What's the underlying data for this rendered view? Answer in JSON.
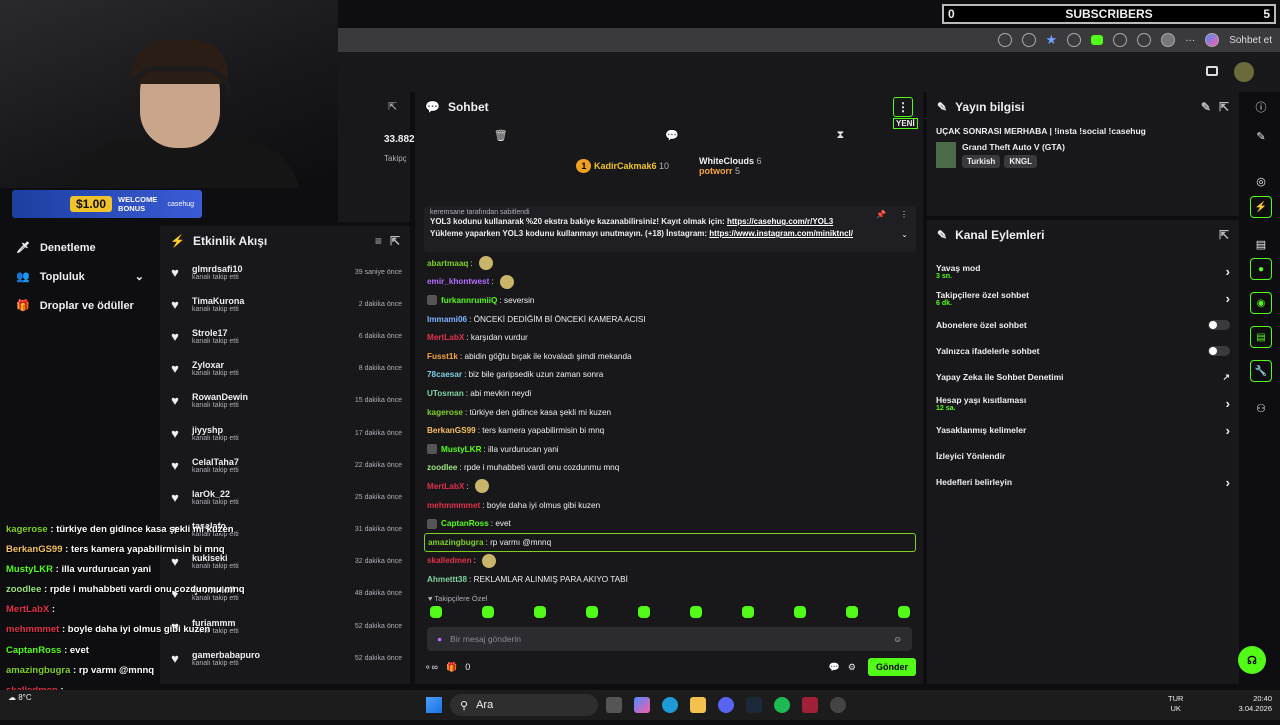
{
  "overlay_bar": {
    "left_count": "0",
    "label": "SUBSCRIBERS",
    "right_count": "5"
  },
  "browser": {
    "copilot_label": "Sohbet et"
  },
  "bonus": {
    "amount": "$1.00",
    "label": "WELCOME BONUS",
    "brand": "casehug"
  },
  "left_nav": [
    {
      "label": "Denetleme",
      "icon": "sword-icon"
    },
    {
      "label": "Topluluk",
      "icon": "community-icon"
    },
    {
      "label": "Droplar ve ödüller",
      "icon": "gift-icon"
    }
  ],
  "stats": {
    "viewers": "33.882",
    "followers_label": "Takipç"
  },
  "feed": {
    "title": "Etkinlik Akışı",
    "items": [
      {
        "name": "glmrdsafi10",
        "sub": "kanalı takip etti",
        "time": "39 saniye önce"
      },
      {
        "name": "TimaKurona",
        "sub": "kanalı takip etti",
        "time": "2 dakika önce"
      },
      {
        "name": "Strole17",
        "sub": "kanalı takip etti",
        "time": "6 dakika önce"
      },
      {
        "name": "Zyloxar",
        "sub": "kanalı takip etti",
        "time": "8 dakika önce"
      },
      {
        "name": "RowanDewin",
        "sub": "kanalı takip etti",
        "time": "15 dakika önce"
      },
      {
        "name": "jiyyshp",
        "sub": "kanalı takip etti",
        "time": "17 dakika önce"
      },
      {
        "name": "CelalTaha7",
        "sub": "kanalı takip etti",
        "time": "22 dakika önce"
      },
      {
        "name": "larOk_22",
        "sub": "kanalı takip etti",
        "time": "25 dakika önce"
      },
      {
        "name": "tasalafo",
        "sub": "kanalı takip etti",
        "time": "31 dakika önce"
      },
      {
        "name": "kukiseki",
        "sub": "kanalı takip etti",
        "time": "32 dakika önce"
      },
      {
        "name": "tjevoudoll",
        "sub": "kanalı takip etti",
        "time": "48 dakika önce"
      },
      {
        "name": "furiammm",
        "sub": "kanalı takip etti",
        "time": "52 dakika önce"
      },
      {
        "name": "gamerbabapuro",
        "sub": "kanalı takip etti",
        "time": "52 dakika önce"
      }
    ]
  },
  "chat": {
    "title": "Sohbet",
    "new_badge": "YENİ",
    "leaders": [
      {
        "name": "KadirCakmak6",
        "count": "10",
        "rank": "1"
      },
      {
        "name": "WhiteClouds",
        "count": "6"
      },
      {
        "name": "potworr",
        "count": "5"
      }
    ],
    "pinned": {
      "by": "keremsane tarafından sabitlendi",
      "line1": "YOL3 kodunu kullanarak %20 ekstra bakiye kazanabilirsiniz! Kayıt olmak için: ",
      "link1": "https://casehug.com/r/YOL3",
      "line2": "Yükleme yaparken YOL3 kodunu kullanmayı unutmayın. (+18) İnstagram: ",
      "link2": "https://www.instagram.com/miniktncl/"
    },
    "messages": [
      {
        "user": "abartmaaq",
        "text": "",
        "color": "#7fd120",
        "emote": true
      },
      {
        "user": "emir_khontwest",
        "text": "",
        "color": "#b36bff",
        "emote": true
      },
      {
        "user": "furkannrumiiQ",
        "text": "seversin",
        "color": "#53fc18",
        "badge": true
      },
      {
        "user": "Immami06",
        "text": "ÖNCEKİ DEDİĞİM Bİ ÖNCEKİ KAMERA ACISI",
        "color": "#7fb2ff"
      },
      {
        "user": "MertLabX",
        "text": "karşıdan vurdur",
        "color": "#e0304a"
      },
      {
        "user": "Fusst1k",
        "text": "abidin göğtu bıçak ile kovaladı şimdi mekanda",
        "color": "#f4a340"
      },
      {
        "user": "78caesar",
        "text": "biz bile garipsedik uzun zaman sonra",
        "color": "#7ad0e0"
      },
      {
        "user": "UTosman",
        "text": "abi mevkin neydi",
        "color": "#7fd1a0"
      },
      {
        "user": "kagerose",
        "text": "türkiye den gidince kasa şekli mi kuzen",
        "color": "#7fd120"
      },
      {
        "user": "BerkanGS99",
        "text": "ters kamera yapabilirmisin bi mnq",
        "color": "#f4c060"
      },
      {
        "user": "MustyLKR",
        "text": "illa vurdurucan yani",
        "color": "#53fc18",
        "badge": true
      },
      {
        "user": "zoodlee",
        "text": "rpde i muhabbeti vardi onu cozdunmu mnq",
        "color": "#9ee57a"
      },
      {
        "user": "MertLabX",
        "text": "",
        "color": "#e0304a",
        "emote": true
      },
      {
        "user": "mehmmmmet",
        "text": "boyle daha iyi olmus gibi kuzen",
        "color": "#e0304a"
      },
      {
        "user": "CaptanRoss",
        "text": "evet",
        "color": "#53fc18",
        "badge": true
      },
      {
        "user": "amazingbugra",
        "text": "rp varmı @mnnq",
        "color": "#7fd120",
        "highlight": true
      },
      {
        "user": "skalledmen",
        "text": "",
        "color": "#e0304a",
        "emote": true
      },
      {
        "user": "Ahmettt38",
        "text": "REKLAMLAR ALINMIŞ PARA AKIYO TABİ",
        "color": "#7fd1a0"
      }
    ],
    "subs_only_label": "Takipçilere Özel",
    "input_placeholder": "Bir mesaj gönderin",
    "points": "0",
    "send_label": "Gönder"
  },
  "stream_info": {
    "title": "Yayın bilgisi",
    "stream_title": "UÇAK SONRASI MERHABA | !insta !social !casehug",
    "category": "Grand Theft Auto V (GTA)",
    "tags": [
      "Turkish",
      "KNGL"
    ]
  },
  "channel_actions": {
    "title": "Kanal Eylemleri",
    "items": [
      {
        "label": "Yavaş mod",
        "sub": "3 sn.",
        "control": "chevron"
      },
      {
        "label": "Takipçilere özel sohbet",
        "sub": "6 dk.",
        "control": "chevron"
      },
      {
        "label": "Abonelere özel sohbet",
        "sub": "",
        "control": "toggle"
      },
      {
        "label": "Yalnızca ifadelerle sohbet",
        "sub": "",
        "control": "toggle"
      },
      {
        "label": "Yapay Zeka ile Sohbet Denetimi",
        "sub": "",
        "control": "external"
      },
      {
        "label": "Hesap yaşı kısıtlaması",
        "sub": "12 sa.",
        "control": "chevron"
      },
      {
        "label": "Yasaklanmış kelimeler",
        "sub": "",
        "control": "chevron"
      },
      {
        "label": "İzleyici Yönlendir",
        "sub": "",
        "control": "none"
      },
      {
        "label": "Hedefleri belirleyin",
        "sub": "",
        "control": "chevron"
      }
    ]
  },
  "overlay_chat": [
    {
      "user": "kagerose",
      "text": "türkiye den gidince kasa şekli mi kuzen",
      "color": "#7fd120"
    },
    {
      "user": "BerkanGS99",
      "text": "ters kamera yapabilirmisin bi mnq",
      "color": "#f4c060"
    },
    {
      "user": "MustyLKR",
      "text": "illa vurdurucan yani",
      "color": "#53fc18"
    },
    {
      "user": "zoodlee",
      "text": "rpde i muhabbeti vardi onu cozdunmu mnq",
      "color": "#9ee57a"
    },
    {
      "user": "MertLabX",
      "text": "",
      "color": "#e0304a"
    },
    {
      "user": "mehmmmet",
      "text": "boyle daha iyi olmus gibi kuzen",
      "color": "#e0304a"
    },
    {
      "user": "CaptanRoss",
      "text": "evet",
      "color": "#53fc18"
    },
    {
      "user": "amazingbugra",
      "text": "rp varmı @mnnq",
      "color": "#7fd120"
    },
    {
      "user": "skalledmen",
      "text": "",
      "color": "#e0304a"
    },
    {
      "user": "Ahmettt38",
      "text": "REKLAMLAR ALINMIŞ PARA AKIYO TABİ",
      "color": "#7fd1a0"
    }
  ],
  "taskbar": {
    "search": "Ara",
    "weather": "8°C",
    "lang1": "TUR",
    "lang2": "UK",
    "time": "20:40",
    "date": "3.04.2026"
  },
  "colors": {
    "accent": "#53fc18",
    "panel": "#18181b",
    "bg": "#0e0e10"
  }
}
